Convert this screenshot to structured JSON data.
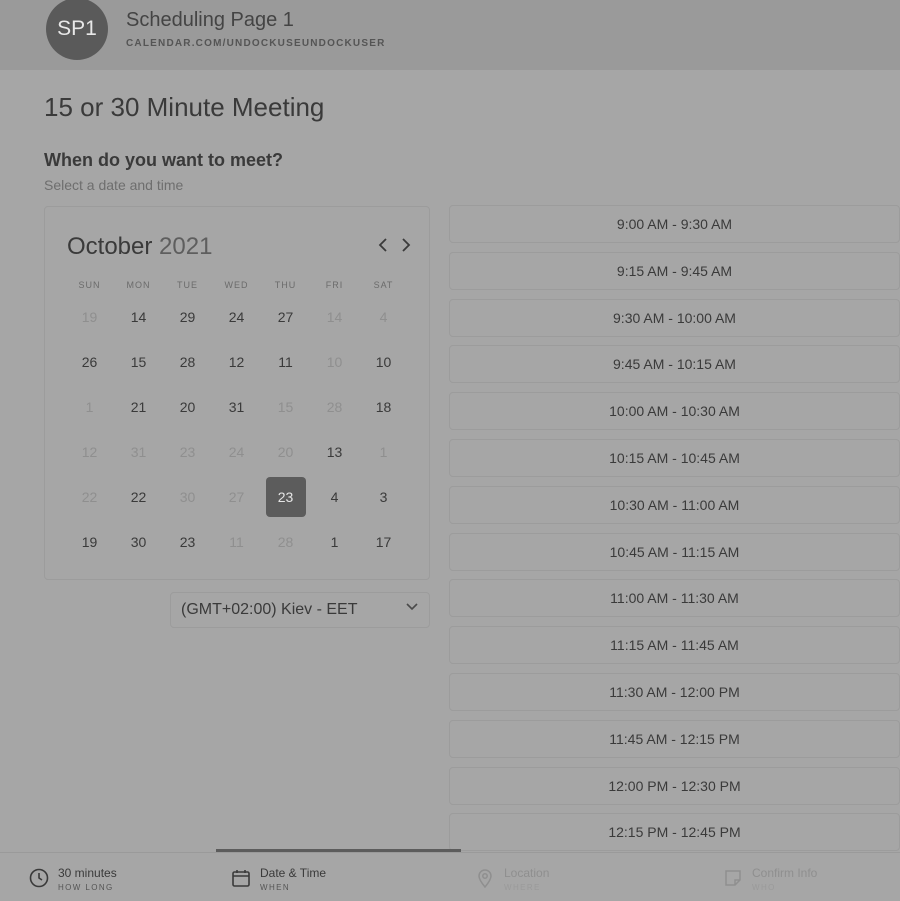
{
  "header": {
    "avatar_initials": "SP1",
    "page_name": "Scheduling Page 1",
    "page_url": "CALENDAR.COM/UNDOCKUSEUNDOCKUSER"
  },
  "meeting": {
    "title": "15 or 30 Minute Meeting",
    "question": "When do you want to meet?",
    "subtitle": "Select a date and time"
  },
  "calendar": {
    "month": "October",
    "year": "2021",
    "prev_icon": "chevron-left-icon",
    "next_icon": "chevron-right-icon",
    "weekdays": [
      "SUN",
      "MON",
      "TUE",
      "WED",
      "THU",
      "FRI",
      "SAT"
    ],
    "weeks": [
      [
        {
          "d": "19",
          "dim": true
        },
        {
          "d": "14",
          "dim": false
        },
        {
          "d": "29",
          "dim": false
        },
        {
          "d": "24",
          "dim": false
        },
        {
          "d": "27",
          "dim": false
        },
        {
          "d": "14",
          "dim": true
        },
        {
          "d": "4",
          "dim": true
        }
      ],
      [
        {
          "d": "26",
          "dim": false
        },
        {
          "d": "15",
          "dim": false
        },
        {
          "d": "28",
          "dim": false
        },
        {
          "d": "12",
          "dim": false
        },
        {
          "d": "11",
          "dim": false
        },
        {
          "d": "10",
          "dim": true
        },
        {
          "d": "10",
          "dim": false
        }
      ],
      [
        {
          "d": "1",
          "dim": true
        },
        {
          "d": "21",
          "dim": false
        },
        {
          "d": "20",
          "dim": false
        },
        {
          "d": "31",
          "dim": false
        },
        {
          "d": "15",
          "dim": true
        },
        {
          "d": "28",
          "dim": true
        },
        {
          "d": "18",
          "dim": false
        }
      ],
      [
        {
          "d": "12",
          "dim": true
        },
        {
          "d": "31",
          "dim": true
        },
        {
          "d": "23",
          "dim": true
        },
        {
          "d": "24",
          "dim": true
        },
        {
          "d": "20",
          "dim": true
        },
        {
          "d": "13",
          "dim": false
        },
        {
          "d": "1",
          "dim": true
        }
      ],
      [
        {
          "d": "22",
          "dim": true
        },
        {
          "d": "22",
          "dim": false
        },
        {
          "d": "30",
          "dim": true
        },
        {
          "d": "27",
          "dim": true
        },
        {
          "d": "23",
          "dim": false,
          "selected": true
        },
        {
          "d": "4",
          "dim": false
        },
        {
          "d": "3",
          "dim": false
        }
      ],
      [
        {
          "d": "19",
          "dim": false
        },
        {
          "d": "30",
          "dim": false
        },
        {
          "d": "23",
          "dim": false
        },
        {
          "d": "11",
          "dim": true
        },
        {
          "d": "28",
          "dim": true
        },
        {
          "d": "1",
          "dim": false
        },
        {
          "d": "17",
          "dim": false
        }
      ]
    ]
  },
  "timezone": {
    "value": "(GMT+02:00) Kiev - EET",
    "icon": "chevron-down-icon"
  },
  "time_slots": [
    "9:00 AM - 9:30 AM",
    "9:15 AM - 9:45 AM",
    "9:30 AM - 10:00 AM",
    "9:45 AM - 10:15 AM",
    "10:00 AM - 10:30 AM",
    "10:15 AM - 10:45 AM",
    "10:30 AM - 11:00 AM",
    "10:45 AM - 11:15 AM",
    "11:00 AM - 11:30 AM",
    "11:15 AM - 11:45 AM",
    "11:30 AM - 12:00 PM",
    "11:45 AM - 12:15 PM",
    "12:00 PM - 12:30 PM",
    "12:15 PM - 12:45 PM"
  ],
  "footer": {
    "steps": [
      {
        "icon": "clock-icon",
        "label": "30 minutes",
        "sub": "HOW LONG",
        "disabled": false
      },
      {
        "icon": "calendar-icon",
        "label": "Date & Time",
        "sub": "WHEN",
        "disabled": false,
        "active": true
      },
      {
        "icon": "location-pin-icon",
        "label": "Location",
        "sub": "WHERE",
        "disabled": true
      },
      {
        "icon": "note-icon",
        "label": "Confirm Info",
        "sub": "WHO",
        "disabled": true
      }
    ]
  },
  "colors": {
    "background": "#a6a6a6",
    "header": "#9a9a9a",
    "selected_day": "#5c5c5c",
    "avatar": "#5a5a5a"
  }
}
